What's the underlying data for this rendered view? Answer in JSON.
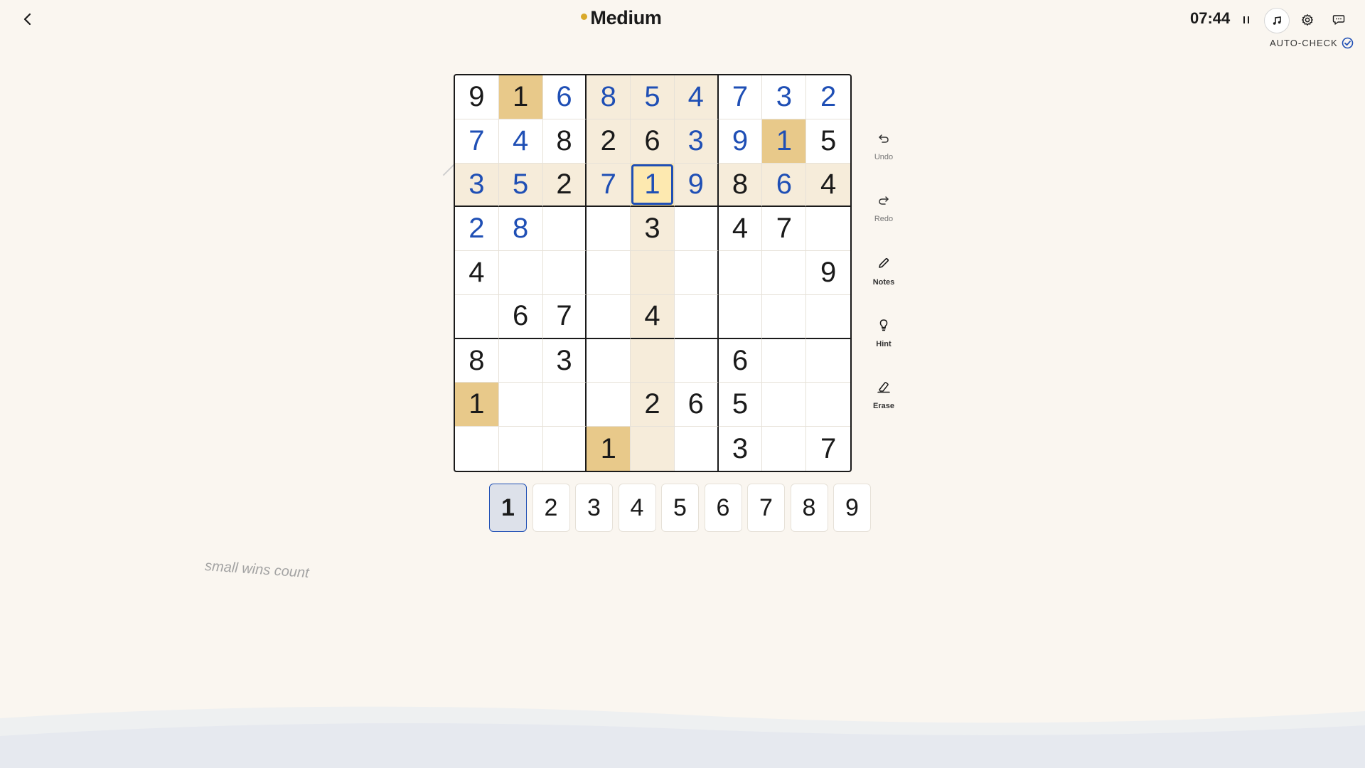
{
  "header": {
    "title": "Medium",
    "timer": "07:44",
    "auto_check_label": "AUTO-CHECK"
  },
  "tools": [
    {
      "id": "undo",
      "label": "Undo",
      "icon": "undo-icon"
    },
    {
      "id": "redo",
      "label": "Redo",
      "icon": "redo-icon"
    },
    {
      "id": "notes",
      "label": "Notes",
      "icon": "pencil-icon"
    },
    {
      "id": "hint",
      "label": "Hint",
      "icon": "lightbulb-icon"
    },
    {
      "id": "erase",
      "label": "Erase",
      "icon": "eraser-icon"
    }
  ],
  "board": {
    "rows": [
      [
        {
          "v": "9",
          "t": "given"
        },
        {
          "v": "1",
          "t": "given"
        },
        {
          "v": "6",
          "t": "user"
        },
        {
          "v": "8",
          "t": "user"
        },
        {
          "v": "5",
          "t": "user"
        },
        {
          "v": "4",
          "t": "user"
        },
        {
          "v": "7",
          "t": "user"
        },
        {
          "v": "3",
          "t": "user"
        },
        {
          "v": "2",
          "t": "user"
        }
      ],
      [
        {
          "v": "7",
          "t": "user"
        },
        {
          "v": "4",
          "t": "user"
        },
        {
          "v": "8",
          "t": "given"
        },
        {
          "v": "2",
          "t": "given"
        },
        {
          "v": "6",
          "t": "given"
        },
        {
          "v": "3",
          "t": "user"
        },
        {
          "v": "9",
          "t": "user"
        },
        {
          "v": "1",
          "t": "user"
        },
        {
          "v": "5",
          "t": "given"
        }
      ],
      [
        {
          "v": "3",
          "t": "user"
        },
        {
          "v": "5",
          "t": "user"
        },
        {
          "v": "2",
          "t": "given"
        },
        {
          "v": "7",
          "t": "user"
        },
        {
          "v": "1",
          "t": "user"
        },
        {
          "v": "9",
          "t": "user"
        },
        {
          "v": "8",
          "t": "given"
        },
        {
          "v": "6",
          "t": "user"
        },
        {
          "v": "4",
          "t": "given"
        }
      ],
      [
        {
          "v": "2",
          "t": "user"
        },
        {
          "v": "8",
          "t": "user"
        },
        {
          "v": "",
          "t": ""
        },
        {
          "v": "",
          "t": ""
        },
        {
          "v": "3",
          "t": "given"
        },
        {
          "v": "",
          "t": ""
        },
        {
          "v": "4",
          "t": "given"
        },
        {
          "v": "7",
          "t": "given"
        },
        {
          "v": "",
          "t": ""
        }
      ],
      [
        {
          "v": "4",
          "t": "given"
        },
        {
          "v": "",
          "t": ""
        },
        {
          "v": "",
          "t": ""
        },
        {
          "v": "",
          "t": ""
        },
        {
          "v": "",
          "t": ""
        },
        {
          "v": "",
          "t": ""
        },
        {
          "v": "",
          "t": ""
        },
        {
          "v": "",
          "t": ""
        },
        {
          "v": "9",
          "t": "given"
        }
      ],
      [
        {
          "v": "",
          "t": ""
        },
        {
          "v": "6",
          "t": "given"
        },
        {
          "v": "7",
          "t": "given"
        },
        {
          "v": "",
          "t": ""
        },
        {
          "v": "4",
          "t": "given"
        },
        {
          "v": "",
          "t": ""
        },
        {
          "v": "",
          "t": ""
        },
        {
          "v": "",
          "t": ""
        },
        {
          "v": "",
          "t": ""
        }
      ],
      [
        {
          "v": "8",
          "t": "given"
        },
        {
          "v": "",
          "t": ""
        },
        {
          "v": "3",
          "t": "given"
        },
        {
          "v": "",
          "t": ""
        },
        {
          "v": "",
          "t": ""
        },
        {
          "v": "",
          "t": ""
        },
        {
          "v": "6",
          "t": "given"
        },
        {
          "v": "",
          "t": ""
        },
        {
          "v": "",
          "t": ""
        }
      ],
      [
        {
          "v": "1",
          "t": "given"
        },
        {
          "v": "",
          "t": ""
        },
        {
          "v": "",
          "t": ""
        },
        {
          "v": "",
          "t": ""
        },
        {
          "v": "2",
          "t": "given"
        },
        {
          "v": "6",
          "t": "given"
        },
        {
          "v": "5",
          "t": "given"
        },
        {
          "v": "",
          "t": ""
        },
        {
          "v": "",
          "t": ""
        }
      ],
      [
        {
          "v": "",
          "t": ""
        },
        {
          "v": "",
          "t": ""
        },
        {
          "v": "",
          "t": ""
        },
        {
          "v": "1",
          "t": "given"
        },
        {
          "v": "",
          "t": ""
        },
        {
          "v": "",
          "t": ""
        },
        {
          "v": "3",
          "t": "given"
        },
        {
          "v": "",
          "t": ""
        },
        {
          "v": "7",
          "t": "given"
        }
      ]
    ],
    "selected_row": 2,
    "selected_col": 4,
    "selected_value": "1"
  },
  "numpad": {
    "keys": [
      "1",
      "2",
      "3",
      "4",
      "5",
      "6",
      "7",
      "8",
      "9"
    ],
    "active": "1"
  },
  "motto": "small wins count",
  "colors": {
    "background": "#faf6f0",
    "user_digit": "#1f4fb5",
    "peer_highlight": "#f6ecda",
    "same_digit_highlight": "#e8c98a",
    "selected_cell": "#fde9b0",
    "difficulty_dot": "#d9a92a"
  }
}
